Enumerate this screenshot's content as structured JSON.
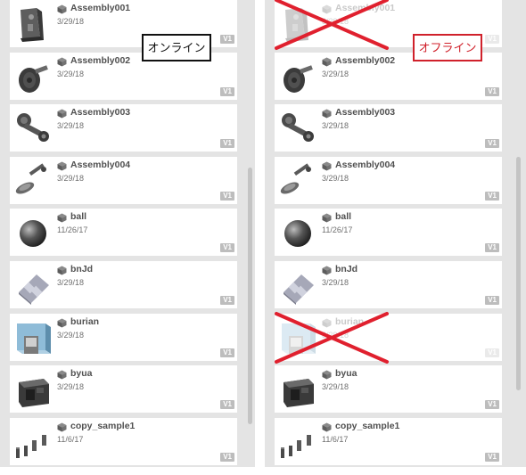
{
  "status": {
    "online_label": "オンライン",
    "offline_label": "オフライン"
  },
  "colors": {
    "cross_mark": "#e0202e",
    "offline_border": "#d0212b",
    "online_border": "#111111",
    "panel_bg": "#e4e4e4"
  },
  "items": [
    {
      "name": "Assembly001",
      "date": "3/29/18",
      "version": "V1",
      "icon": "bracket-part-thumbnail",
      "offline_available": false
    },
    {
      "name": "Assembly002",
      "date": "3/29/18",
      "version": "V1",
      "icon": "hub-part-thumbnail",
      "offline_available": true
    },
    {
      "name": "Assembly003",
      "date": "3/29/18",
      "version": "V1",
      "icon": "linkage-part-thumbnail",
      "offline_available": true
    },
    {
      "name": "Assembly004",
      "date": "3/29/18",
      "version": "V1",
      "icon": "shaft-part-thumbnail",
      "offline_available": true
    },
    {
      "name": "ball",
      "date": "11/26/17",
      "version": "V1",
      "icon": "sphere-thumbnail",
      "offline_available": true
    },
    {
      "name": "bnJd",
      "date": "3/29/18",
      "version": "V1",
      "icon": "plate-thumbnail",
      "offline_available": true
    },
    {
      "name": "burian",
      "date": "3/29/18",
      "version": "V1",
      "icon": "box-thumbnail",
      "offline_available": false
    },
    {
      "name": "byua",
      "date": "3/29/18",
      "version": "V1",
      "icon": "block-thumbnail",
      "offline_available": true
    },
    {
      "name": "copy_sample1",
      "date": "11/6/17",
      "version": "V1",
      "icon": "pins-thumbnail",
      "offline_available": true
    }
  ]
}
